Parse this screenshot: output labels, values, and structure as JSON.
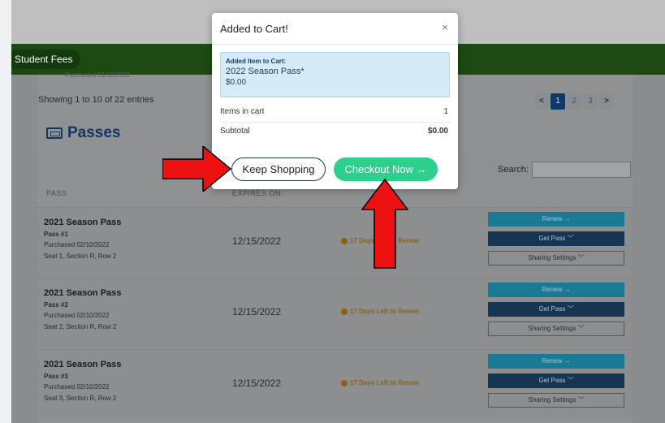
{
  "header": {
    "nav_item": "Student Fees"
  },
  "list": {
    "truncated_purchase": "Purchased 01/18/2022",
    "showing_text": "Showing 1 to 10 of 22 entries",
    "pager": {
      "prev": "<",
      "pages": [
        "1",
        "2",
        "3"
      ],
      "next": ">"
    }
  },
  "passes": {
    "title": "Passes",
    "search_label": "Search:",
    "columns": {
      "pass": "PASS",
      "expires": "EXPIRES ON"
    },
    "rows": [
      {
        "title": "2021 Season Pass",
        "pass": "Pass #1",
        "purchased": "Purchased 02/10/2022",
        "seat": "Seat 1, Section R, Row 2",
        "expires": "12/15/2022",
        "days": "17 Days Left to Renew",
        "renew": "Renew →",
        "get_pass": "Get Pass ﹀",
        "share": "Sharing Settings ﹀"
      },
      {
        "title": "2021 Season Pass",
        "pass": "Pass #2",
        "purchased": "Purchased 02/10/2022",
        "seat": "Seat 2, Section R, Row 2",
        "expires": "12/15/2022",
        "days": "17 Days Left to Renew",
        "renew": "Renew →",
        "get_pass": "Get Pass ﹀",
        "share": "Sharing Settings ﹀"
      },
      {
        "title": "2021 Season Pass",
        "pass": "Pass #3",
        "purchased": "Purchased 02/10/2022",
        "seat": "Seat 3, Section R, Row 2",
        "expires": "12/15/2022",
        "days": "17 Days Left to Renew",
        "renew": "Renew →",
        "get_pass": "Get Pass ﹀",
        "share": "Sharing Settings ﹀"
      }
    ]
  },
  "modal": {
    "title": "Added to Cart!",
    "close": "×",
    "added_label": "Added Item to Cart:",
    "item_name": "2022 Season Pass*",
    "item_price": "$0.00",
    "items_label": "Items in cart",
    "items_value": "1",
    "subtotal_label": "Subtotal",
    "subtotal_value": "$0.00",
    "keep_shopping": "Keep Shopping",
    "checkout": "Checkout Now →"
  },
  "colors": {
    "accent_green": "#2ccf8b",
    "navy": "#0f3763",
    "arrow_red": "#ee1111"
  }
}
